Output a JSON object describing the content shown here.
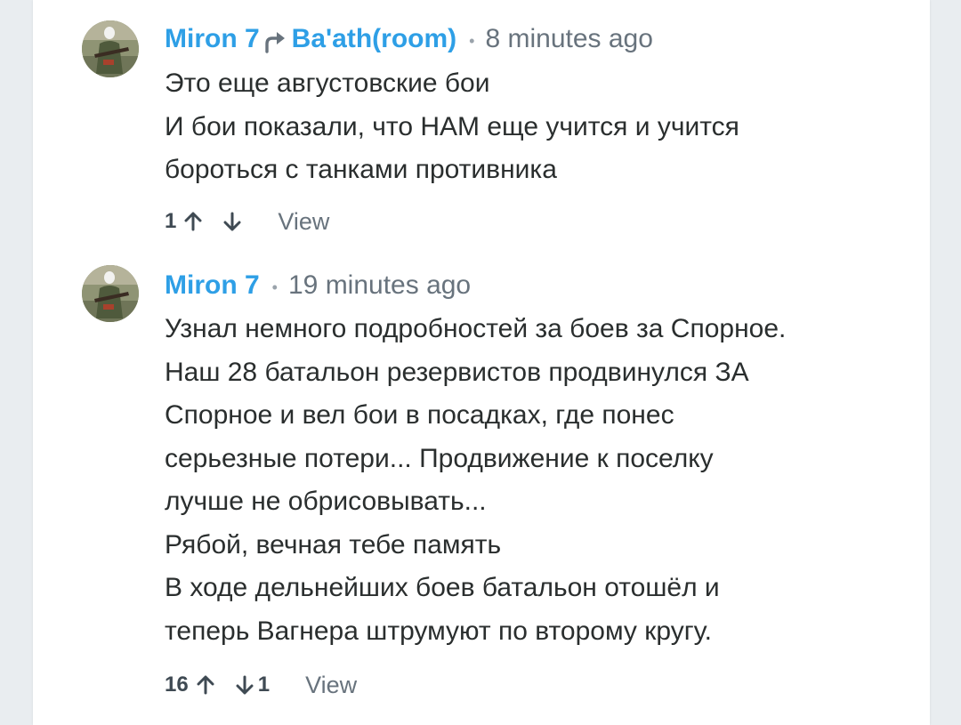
{
  "comments": [
    {
      "author": "Miron 7",
      "reply_to": "Ba'ath(room)",
      "time": "8 minutes ago",
      "lines": [
        "Это еще августовские бои",
        "И бои показали, что НАМ еще учится и учится",
        "бороться с танками противника"
      ],
      "upvotes": "1",
      "downvotes": "",
      "view_label": "View"
    },
    {
      "author": "Miron 7",
      "time": "19 minutes ago",
      "lines": [
        "Узнал немного подробностей за боев за Спорное.",
        "Наш 28 батальон резервистов продвинулся ЗА",
        "Спорное и вел бои в посадках, где понес",
        "серьезные потери... Продвижение к поселку",
        "лучше не обрисовывать...",
        "Рябой, вечная тебе память",
        "В ходе дельнейших боев батальон отошёл и",
        "теперь Вагнера штрумуют по второму кругу."
      ],
      "upvotes": "16",
      "downvotes": "1",
      "view_label": "View"
    }
  ],
  "colors": {
    "author_link": "#2e9fe6",
    "body_text": "#2a2e2e",
    "muted_text": "#68737d",
    "page_background": "#e9edf0"
  },
  "icons": {
    "reply": "reply-arrow-icon",
    "upvote": "arrow-up-icon",
    "downvote": "arrow-down-icon"
  }
}
